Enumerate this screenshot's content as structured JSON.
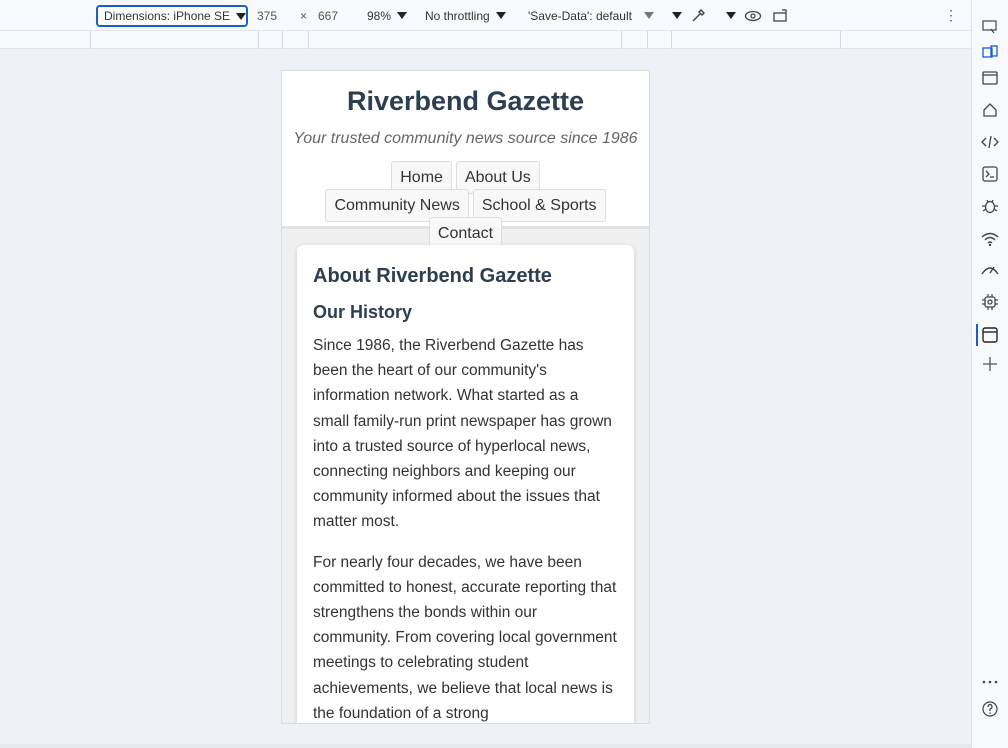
{
  "devtools": {
    "dimensions_label": "Dimensions: iPhone SE",
    "width": "375",
    "times": "×",
    "height": "667",
    "zoom": "98%",
    "throttling": "No throttling",
    "save_data": "'Save-Data': default",
    "more_icon": "⋮"
  },
  "site": {
    "title": "Riverbend Gazette",
    "tagline": "Your trusted community news source since 1986",
    "nav": [
      "Home",
      "About Us",
      "Community News",
      "School & Sports",
      "Contact"
    ]
  },
  "content": {
    "heading": "About Riverbend Gazette",
    "subheading": "Our History",
    "paragraphs": [
      "Since 1986, the Riverbend Gazette has been the heart of our community's information network. What started as a small family-run print newspaper has grown into a trusted source of hyperlocal news, connecting neighbors and keeping our community informed about the issues that matter most.",
      "For nearly four decades, we have been committed to honest, accurate reporting that strengthens the bonds within our community. From covering local government meetings to celebrating student achievements, we believe that local news is the foundation of a strong"
    ]
  }
}
